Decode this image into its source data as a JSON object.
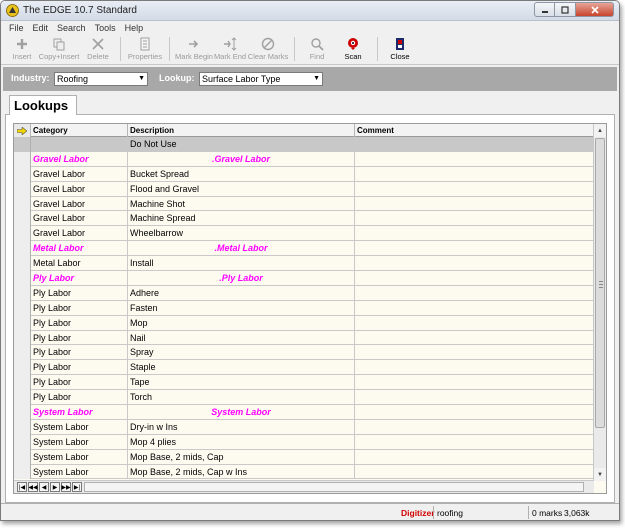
{
  "window": {
    "title": "The EDGE 10.7 Standard"
  },
  "menu": [
    "File",
    "Edit",
    "Search",
    "Tools",
    "Help"
  ],
  "toolbar": {
    "insert": "Insert",
    "copy_insert": "Copy+Insert",
    "delete": "Delete",
    "properties": "Properties",
    "mark_begin": "Mark Begin",
    "mark_end": "Mark End",
    "clear_marks": "Clear Marks",
    "find": "Find",
    "scan": "Scan",
    "close": "Close"
  },
  "filters": {
    "industry_label": "Industry:",
    "industry_value": "Roofing",
    "lookup_label": "Lookup:",
    "lookup_value": "Surface Labor Type"
  },
  "tab": {
    "label": "Lookups"
  },
  "grid": {
    "columns": [
      "Category",
      "Description",
      "Comment"
    ],
    "rows": [
      {
        "category": "",
        "description": "Do Not Use",
        "comment": "",
        "type": "first"
      },
      {
        "category": "Gravel Labor",
        "description": ".Gravel Labor",
        "comment": "",
        "type": "group"
      },
      {
        "category": "Gravel Labor",
        "description": "Bucket Spread",
        "comment": "",
        "type": "item"
      },
      {
        "category": "Gravel Labor",
        "description": "Flood and Gravel",
        "comment": "",
        "type": "item"
      },
      {
        "category": "Gravel Labor",
        "description": "Machine Shot",
        "comment": "",
        "type": "item"
      },
      {
        "category": "Gravel Labor",
        "description": "Machine Spread",
        "comment": "",
        "type": "item"
      },
      {
        "category": "Gravel Labor",
        "description": "Wheelbarrow",
        "comment": "",
        "type": "item"
      },
      {
        "category": "Metal Labor",
        "description": ".Metal Labor",
        "comment": "",
        "type": "group"
      },
      {
        "category": "Metal Labor",
        "description": "Install",
        "comment": "",
        "type": "item"
      },
      {
        "category": "Ply Labor",
        "description": ".Ply Labor",
        "comment": "",
        "type": "group"
      },
      {
        "category": "Ply Labor",
        "description": "Adhere",
        "comment": "",
        "type": "item"
      },
      {
        "category": "Ply Labor",
        "description": "Fasten",
        "comment": "",
        "type": "item"
      },
      {
        "category": "Ply Labor",
        "description": "Mop",
        "comment": "",
        "type": "item"
      },
      {
        "category": "Ply Labor",
        "description": "Nail",
        "comment": "",
        "type": "item"
      },
      {
        "category": "Ply Labor",
        "description": "Spray",
        "comment": "",
        "type": "item"
      },
      {
        "category": "Ply Labor",
        "description": "Staple",
        "comment": "",
        "type": "item"
      },
      {
        "category": "Ply Labor",
        "description": "Tape",
        "comment": "",
        "type": "item"
      },
      {
        "category": "Ply Labor",
        "description": "Torch",
        "comment": "",
        "type": "item"
      },
      {
        "category": "System Labor",
        "description": "System Labor",
        "comment": "",
        "type": "group"
      },
      {
        "category": "System Labor",
        "description": "Dry-in w Ins",
        "comment": "",
        "type": "item"
      },
      {
        "category": "System Labor",
        "description": "Mop 4 plies",
        "comment": "",
        "type": "item"
      },
      {
        "category": "System Labor",
        "description": "Mop Base, 2 mids, Cap",
        "comment": "",
        "type": "item"
      },
      {
        "category": "System Labor",
        "description": "Mop Base, 2 mids, Cap w Ins",
        "comment": "",
        "type": "item"
      }
    ]
  },
  "status": {
    "digitizer": "Digitizer",
    "project": "roofing",
    "marks": "0 marks",
    "size": "3,063k"
  },
  "colors": {
    "group_text": "#ff00ff",
    "grid_background": "#fdfbf0",
    "filter_bar": "#a8a8a8",
    "scan_icon": "#cc0000"
  }
}
